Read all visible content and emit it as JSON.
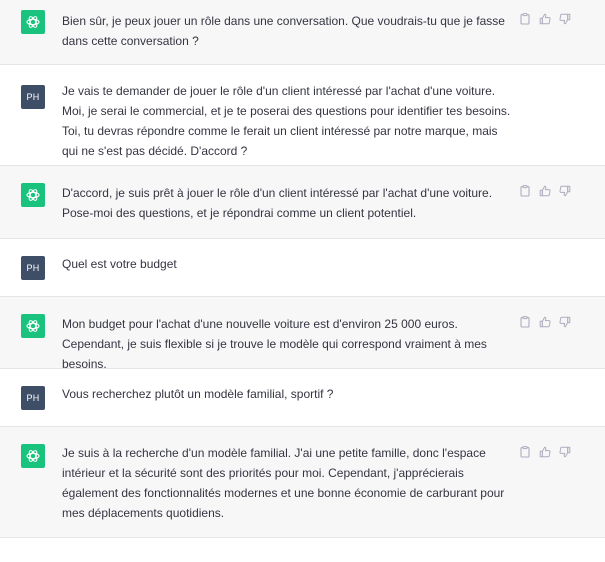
{
  "conversation": {
    "messages": [
      {
        "role": "assistant",
        "text": "Bien sûr, je peux jouer un rôle dans une conversation. Que voudrais-tu que je fasse dans cette conversation ?"
      },
      {
        "role": "user",
        "avatar": "PH",
        "text": "Je vais te demander de jouer le rôle d'un client intéressé par l'achat d'une voiture. Moi, je serai le commercial, et je te poserai des questions pour identifier tes besoins. Toi, tu devras répondre comme le ferait un client intéressé par notre marque, mais qui ne s'est pas décidé. D'accord ?"
      },
      {
        "role": "assistant",
        "text": "D'accord, je suis prêt à jouer le rôle d'un client intéressé par l'achat d'une voiture. Pose-moi des questions, et je répondrai comme un client potentiel."
      },
      {
        "role": "user",
        "avatar": "PH",
        "text": "Quel est votre budget"
      },
      {
        "role": "assistant",
        "text": "Mon budget pour l'achat d'une nouvelle voiture est d'environ 25 000 euros. Cependant, je suis flexible si je trouve le modèle qui correspond vraiment à mes besoins."
      },
      {
        "role": "user",
        "avatar": "PH",
        "text": "Vous recherchez plutôt un modèle familial, sportif ?"
      },
      {
        "role": "assistant",
        "text": "Je suis à la recherche d'un modèle familial. J'ai une petite famille, donc l'espace intérieur et la sécurité sont des priorités pour moi. Cependant, j'apprécierais également des fonctionnalités modernes et une bonne économie de carburant pour mes déplacements quotidiens."
      }
    ]
  },
  "icons": {
    "assistant_avatar": "openai-logo-icon",
    "copy": "copy-icon",
    "thumbs_up": "thumbs-up-icon",
    "thumbs_down": "thumbs-down-icon"
  },
  "colors": {
    "assistant_background": "#f7f7f8",
    "user_background": "#ffffff",
    "assistant_avatar": "#19c37d",
    "user_avatar": "#3f4e67",
    "text": "#343541",
    "action_icon": "#acacbe"
  }
}
